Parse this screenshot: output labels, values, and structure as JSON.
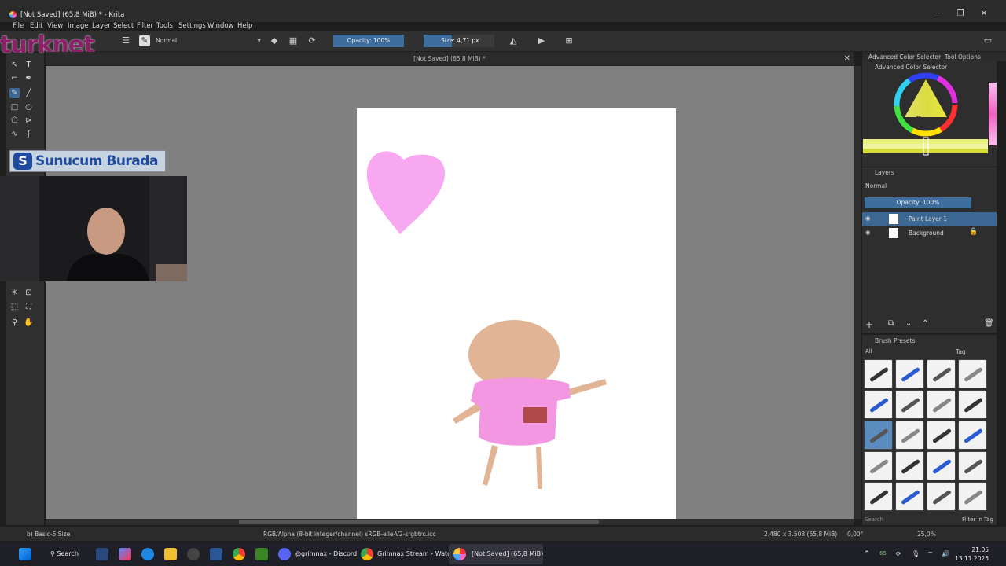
{
  "window": {
    "title": "[Not Saved]  (65,8 MiB) * - Krita"
  },
  "menu": [
    "File",
    "Edit",
    "View",
    "Image",
    "Layer",
    "Select",
    "Filter",
    "Tools",
    "Settings",
    "Window",
    "Help"
  ],
  "toolbar": {
    "blend_mode": "Normal",
    "opacity_label": "Opacity: 100%",
    "size_label": "Size: 4,71 px"
  },
  "overlay": {
    "brand": "turknet",
    "banner": "Sunucum Burada"
  },
  "document": {
    "tab_title": "[Not Saved]  (65,8 MiB) *"
  },
  "right_panel": {
    "tabs": [
      "Advanced Color Selector",
      "Tool Options"
    ],
    "color_selector_title": "Advanced Color Selector",
    "layers_title": "Layers",
    "layers_blend": "Normal",
    "layers_opacity": "Opacity:  100%",
    "layers": [
      {
        "name": "Paint Layer 1",
        "selected": true
      },
      {
        "name": "Background",
        "selected": false
      }
    ],
    "brush_presets_title": "Brush Presets",
    "brush_filter": "All",
    "tag_label": "Tag",
    "search_placeholder": "Search",
    "filter_in_tag": "Filter in Tag"
  },
  "status": {
    "brush": "b) Basic-5 Size",
    "color_space": "RGB/Alpha (8-bit integer/channel)  sRGB-elle-V2-srgbtrc.icc",
    "dimensions": "2.480 x 3.508 (65,8 MiB)",
    "rotation": "0,00°",
    "zoom": "25,0%"
  },
  "taskbar": {
    "search": "Search",
    "discord": "@grimnax - Discord",
    "chrome": "Grimnax Stream - Watcl",
    "krita": "[Not Saved]  (65,8 MiB)",
    "tray_num": "65",
    "time": "21:05",
    "date": "13.11.2025"
  },
  "colors": {
    "accent": "#3d6793",
    "canvas_bg": "#808080",
    "heart": "#f8a8f0",
    "skin": "#e0b494",
    "dress": "#f497e2",
    "pocket": "#b04a4a"
  }
}
